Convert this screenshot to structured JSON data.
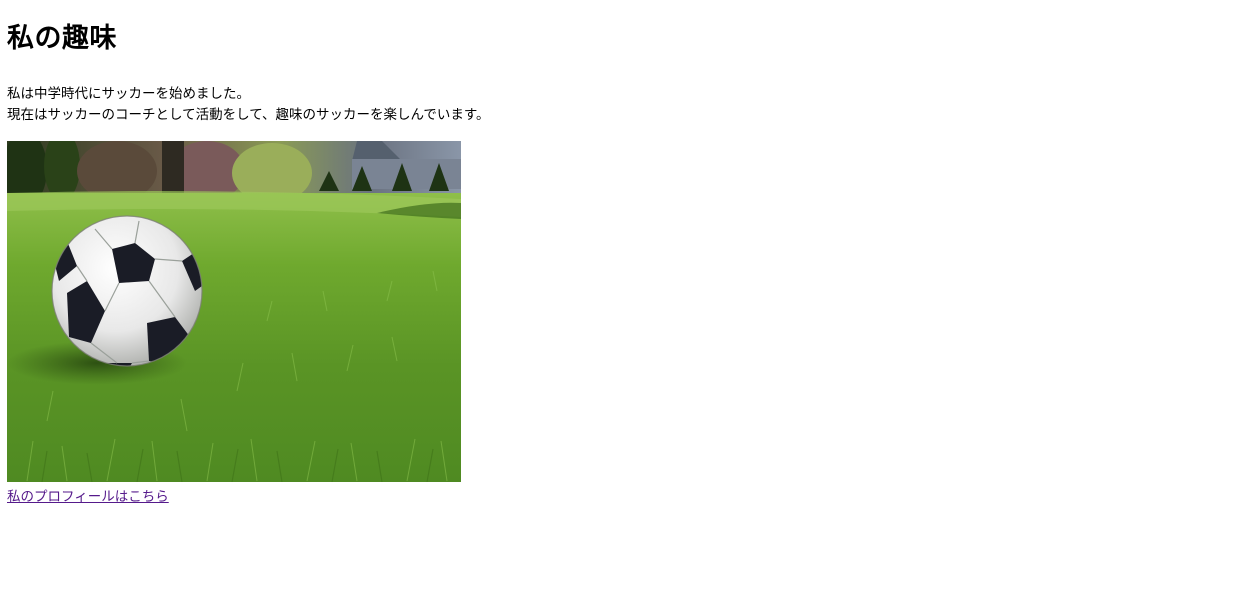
{
  "heading": "私の趣味",
  "paragraph": {
    "line1": "私は中学時代にサッカーを始めました。",
    "line2": "現在はサッカーのコーチとして活動をして、趣味のサッカーを楽しんでいます。"
  },
  "image": {
    "subject": "soccer-ball-on-grass"
  },
  "link": {
    "label": "私のプロフィールはこちら",
    "color": "#551a8b"
  }
}
